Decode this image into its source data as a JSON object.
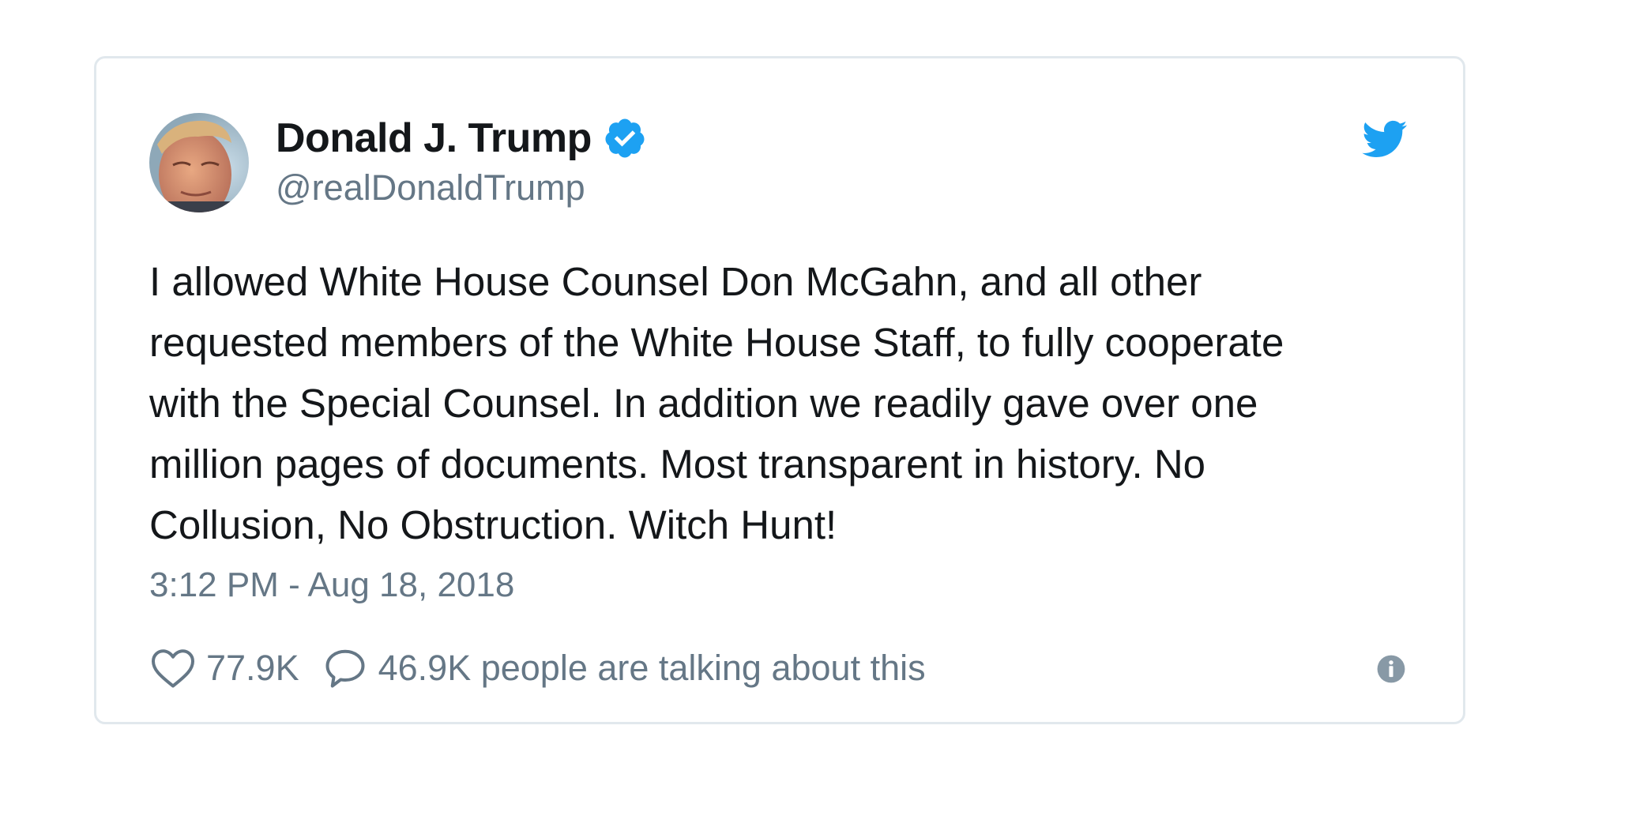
{
  "user": {
    "display_name": "Donald J. Trump",
    "handle": "@realDonaldTrump",
    "verified": true
  },
  "tweet": {
    "lines": [
      "I allowed White House Counsel Don McGahn, and all other",
      "requested members of the White House Staff, to fully cooperate",
      "with the Special Counsel. In addition we readily gave over one",
      "million pages of documents. Most transparent in history. No",
      "Collusion, No Obstruction. Witch Hunt!"
    ],
    "timestamp": "3:12 PM - Aug 18, 2018"
  },
  "engagement": {
    "likes": "77.9K",
    "talking": "46.9K people are talking about this"
  },
  "icons": {
    "brand": "twitter-bird-icon",
    "verified": "verified-badge-icon",
    "like": "heart-icon",
    "reply": "speech-bubble-icon",
    "info": "info-icon"
  },
  "colors": {
    "brand_blue": "#1da1f2",
    "text_primary": "#14171a",
    "text_secondary": "#657786",
    "border": "#e1e8ed"
  }
}
